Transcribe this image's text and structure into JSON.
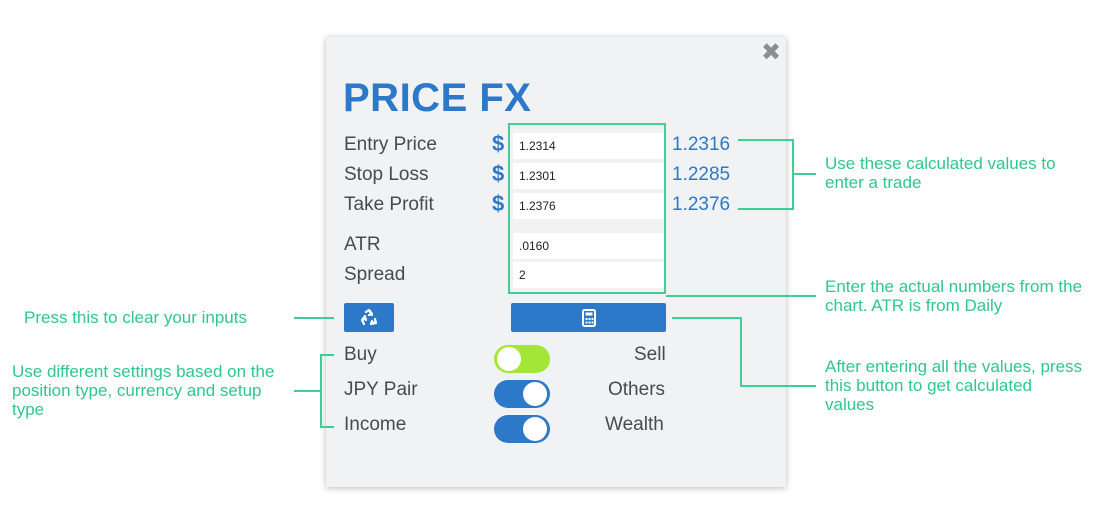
{
  "app": {
    "title": "PRICE FX",
    "close_icon": "close-icon",
    "accent_color": "#2b79c8",
    "annotation_color": "#2ec78d"
  },
  "fields": [
    {
      "label": "Entry Price",
      "currency": "$",
      "value": "1.2314",
      "calculated": "1.2316"
    },
    {
      "label": "Stop Loss",
      "currency": "$",
      "value": "1.2301",
      "calculated": "1.2285"
    },
    {
      "label": "Take Profit",
      "currency": "$",
      "value": "1.2376",
      "calculated": "1.2376"
    },
    {
      "label": "ATR",
      "value": ".0160"
    },
    {
      "label": "Spread",
      "value": "2"
    }
  ],
  "buttons": {
    "clear_icon": "recycle-icon",
    "calculate_icon": "calculator-icon"
  },
  "toggles": [
    {
      "left": "Buy",
      "right": "Sell",
      "state": "left",
      "color": "#a3e635"
    },
    {
      "left": "JPY Pair",
      "right": "Others",
      "state": "right",
      "color": "#2b79c8"
    },
    {
      "left": "Income",
      "right": "Wealth",
      "state": "right",
      "color": "#2b79c8"
    }
  ],
  "annotations": {
    "calculated": "Use these calculated values to enter a trade",
    "inputs": "Enter the actual numbers from the chart. ATR is from Daily",
    "calculate_button": "After entering all the values, press this button to get calculated values",
    "clear": "Press this to clear your inputs",
    "settings": "Use different settings based on the position type, currency and setup type"
  }
}
